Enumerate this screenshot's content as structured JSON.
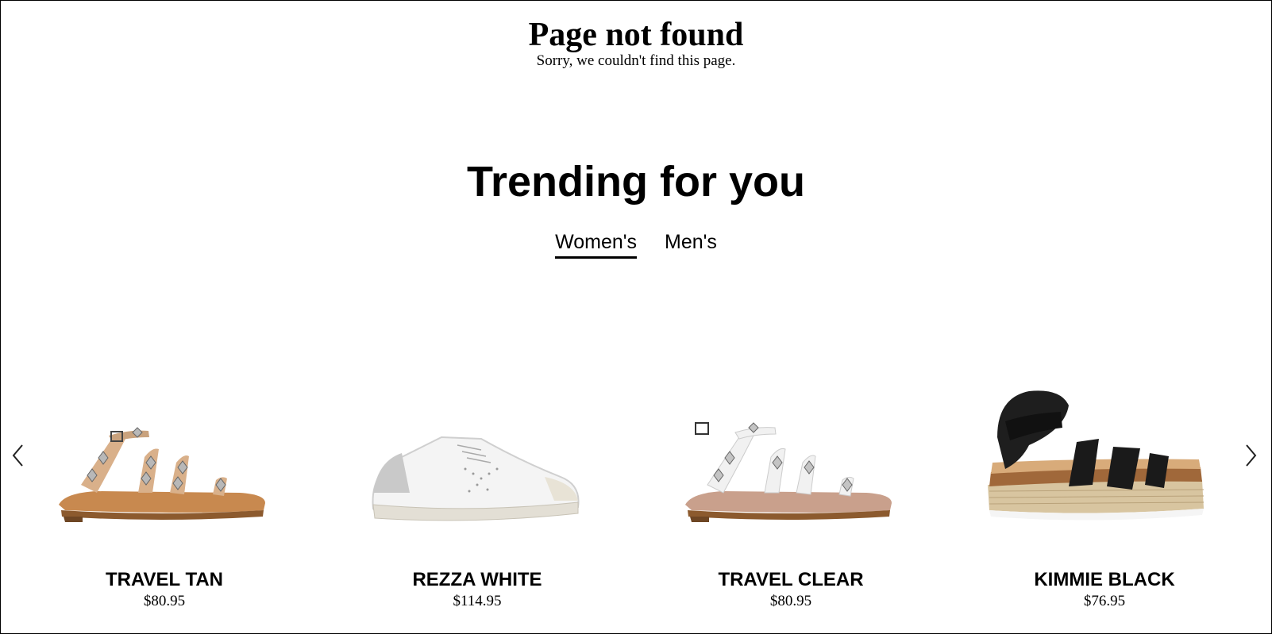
{
  "not_found": {
    "title": "Page not found",
    "message": "Sorry, we couldn't find this page."
  },
  "trending": {
    "title": "Trending for you",
    "tabs": [
      {
        "label": "Women's",
        "active": true
      },
      {
        "label": "Men's",
        "active": false
      }
    ]
  },
  "carousel": {
    "prev_icon": "chevron-left-icon",
    "next_icon": "chevron-right-icon",
    "products": [
      {
        "name": "TRAVEL TAN",
        "price": "$80.95",
        "image": "tan-studded-strappy-sandal"
      },
      {
        "name": "REZZA WHITE",
        "price": "$114.95",
        "image": "white-low-top-sneaker"
      },
      {
        "name": "TRAVEL CLEAR",
        "price": "$80.95",
        "image": "clear-studded-strappy-sandal"
      },
      {
        "name": "KIMMIE BLACK",
        "price": "$76.95",
        "image": "black-espadrille-platform-sandal"
      }
    ]
  }
}
